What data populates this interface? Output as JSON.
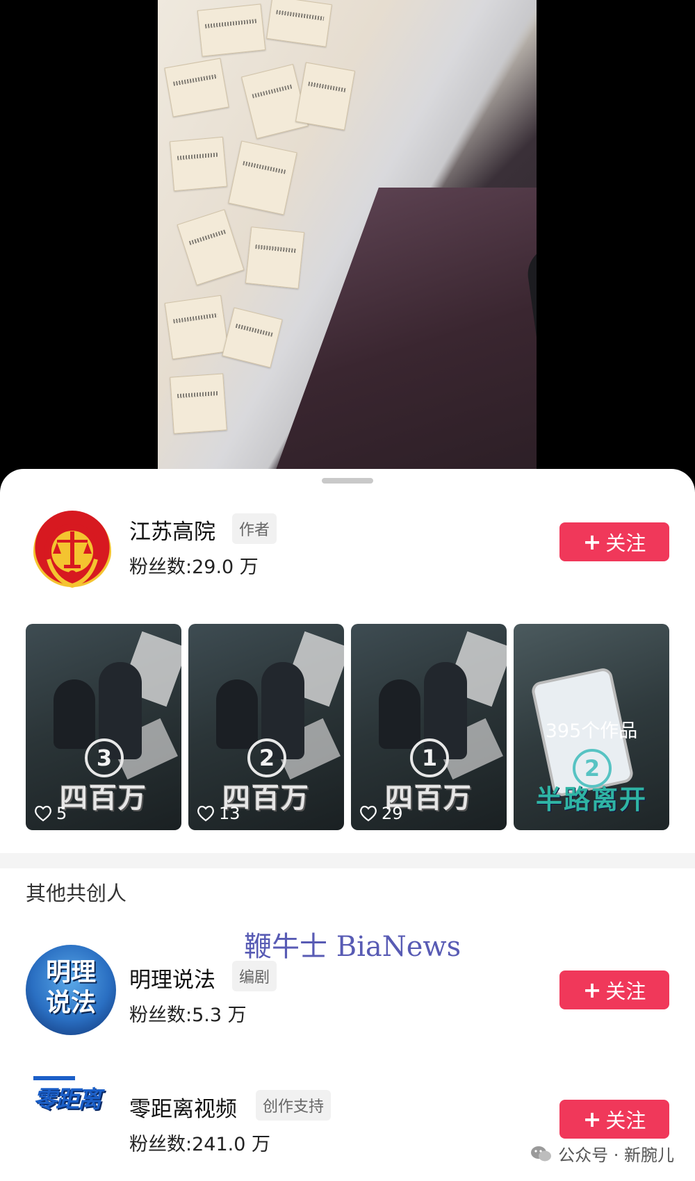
{
  "author": {
    "name": "江苏高院",
    "role": "作者",
    "fans": "粉丝数:29.0 万",
    "follow": "关注"
  },
  "thumbnails": [
    {
      "number": "3",
      "title": "四百万",
      "likes": "5"
    },
    {
      "number": "2",
      "title": "四百万",
      "likes": "13"
    },
    {
      "number": "1",
      "title": "四百万",
      "likes": "29"
    },
    {
      "number": "2",
      "title": "半路离开",
      "overlay": "395个作品"
    }
  ],
  "section_title": "其他共创人",
  "watermark": "鞭牛士 BiaNews",
  "cocreators": [
    {
      "name": "明理说法",
      "role": "编剧",
      "fans": "粉丝数:5.3 万",
      "follow": "关注",
      "avatar_text": "明理说法"
    },
    {
      "name": "零距离视频",
      "role": "创作支持",
      "fans": "粉丝数:241.0 万",
      "follow": "关注",
      "avatar_text": "零距离"
    }
  ],
  "footer": "公众号 · 新腕儿",
  "colors": {
    "follow_button": "#f0385a",
    "sheet_bg": "#ffffff"
  },
  "icons": [
    "court-emblem-icon",
    "heart-icon",
    "plus-icon",
    "wechat-icon"
  ]
}
